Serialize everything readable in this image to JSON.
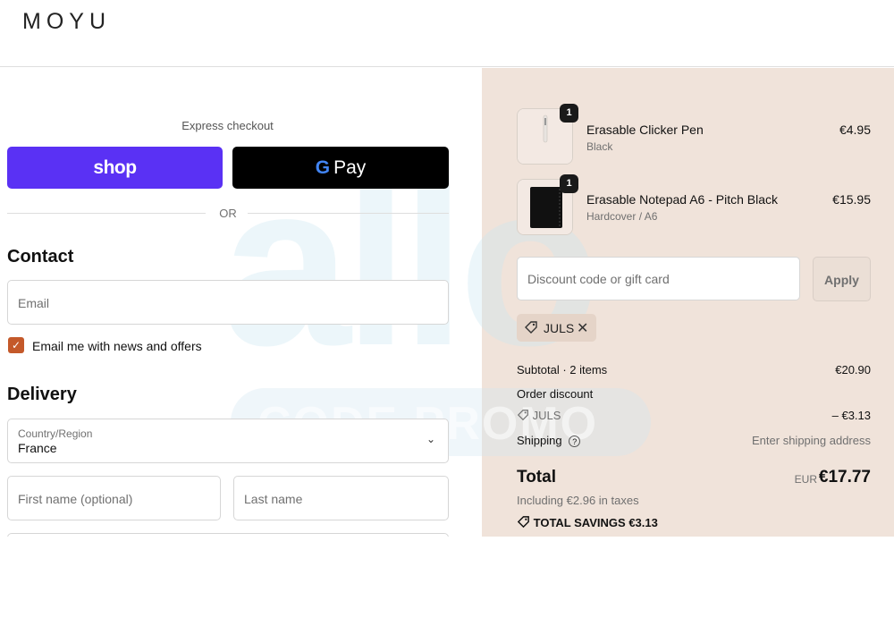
{
  "header": {
    "logo": "MOYU"
  },
  "express": {
    "title": "Express checkout",
    "shop_label": "shop",
    "gpay_g": "G",
    "gpay_label": "Pay",
    "or_text": "OR"
  },
  "contact": {
    "title": "Contact",
    "email_placeholder": "Email",
    "newsletter_label": "Email me with news and offers",
    "newsletter_checked": true
  },
  "delivery": {
    "title": "Delivery",
    "country_label": "Country/Region",
    "country_value": "France",
    "first_name_placeholder": "First name (optional)",
    "last_name_placeholder": "Last name"
  },
  "summary": {
    "items": [
      {
        "qty": "1",
        "name": "Erasable Clicker Pen",
        "variant": "Black",
        "price": "€4.95"
      },
      {
        "qty": "1",
        "name": "Erasable Notepad A6 - Pitch Black",
        "variant": "Hardcover / A6",
        "price": "€15.95"
      }
    ],
    "discount_placeholder": "Discount code or gift card",
    "apply_label": "Apply",
    "applied_code": "JULS",
    "subtotal_label": "Subtotal · 2 items",
    "subtotal_value": "€20.90",
    "order_discount_label": "Order discount",
    "discount_code": "JULS",
    "discount_value": "– €3.13",
    "shipping_label": "Shipping",
    "shipping_value": "Enter shipping address",
    "total_label": "Total",
    "currency": "EUR",
    "total_value": "€17.77",
    "taxes_text": "Including €2.96 in taxes",
    "savings_label": "TOTAL SAVINGS",
    "savings_value": "€3.13"
  },
  "watermark": {
    "big": "allo",
    "pill": "CODE PROMO"
  },
  "colors": {
    "shop_purple": "#5a31f4",
    "summary_bg": "#f0e3da",
    "checkbox_accent": "#c4592a"
  }
}
